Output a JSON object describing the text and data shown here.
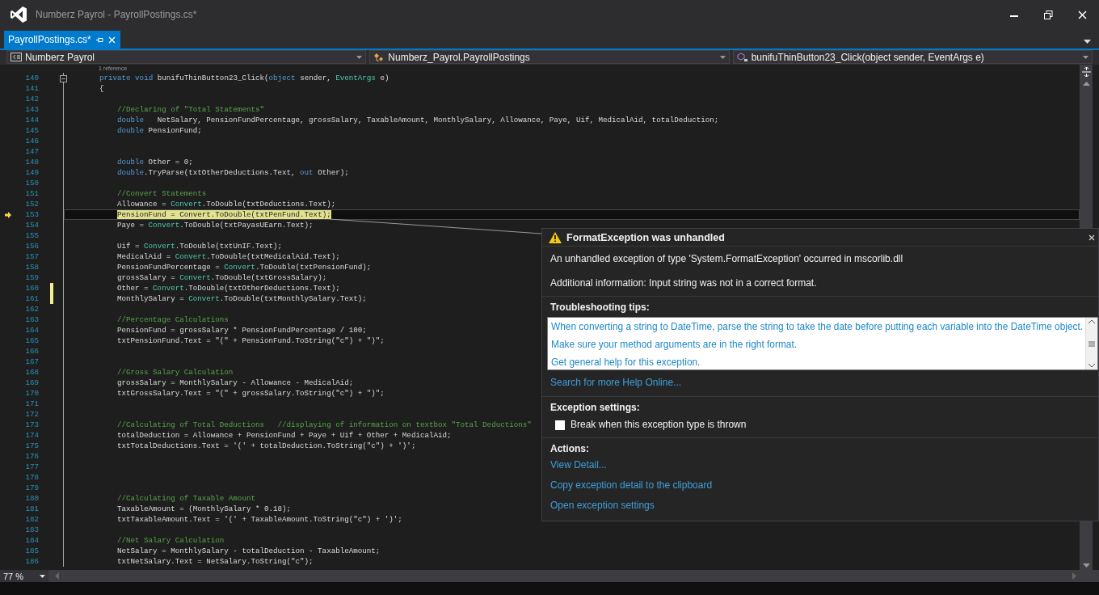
{
  "window": {
    "title": "Numberz Payrol - PayrollPostings.cs*"
  },
  "tabs": [
    {
      "label": "PayrollPostings.cs*",
      "selected": true
    }
  ],
  "navigation_bar": {
    "project": "Numberz Payrol",
    "class": "Numberz_Payrol.PayrollPostings",
    "member": "bunifuThinButton23_Click(object sender, EventArgs e)"
  },
  "editor": {
    "lines": [
      {
        "number": "140",
        "kind": "member",
        "codelens": "1 reference",
        "current": false,
        "changed": false,
        "tokens": [
          {
            "text": "private void",
            "kind": "keyword"
          },
          {
            "text": " bunifuThinButton23_Click(",
            "kind": "plain"
          },
          {
            "text": "object",
            "kind": "keyword"
          },
          {
            "text": " sender, ",
            "kind": "plain"
          },
          {
            "text": "EventArgs",
            "kind": "type"
          },
          {
            "text": " e)",
            "kind": "plain"
          }
        ]
      },
      {
        "number": "141",
        "kind": "member",
        "current": false,
        "changed": false,
        "tokens": [
          {
            "text": "{",
            "kind": "plain"
          }
        ]
      },
      {
        "number": "142",
        "kind": "body",
        "current": false,
        "changed": false
      },
      {
        "number": "143",
        "kind": "body",
        "current": false,
        "changed": false,
        "tokens": [
          {
            "text": "//Declaring of \"Total Statements\"",
            "kind": "comment"
          }
        ]
      },
      {
        "number": "144",
        "kind": "body",
        "current": false,
        "changed": false,
        "tokens": [
          {
            "text": "double",
            "kind": "keyword"
          },
          {
            "text": "   NetSalary, PensionFundPercentage, grossSalary, TaxableAmount, MonthlySalary, Allowance, Paye, Uif, MedicalAid, totalDeduction;",
            "kind": "plain"
          }
        ]
      },
      {
        "number": "145",
        "kind": "body",
        "current": false,
        "changed": false,
        "tokens": [
          {
            "text": "double",
            "kind": "keyword"
          },
          {
            "text": " PensionFund;",
            "kind": "plain"
          }
        ]
      },
      {
        "number": "146",
        "kind": "body",
        "current": false,
        "changed": false
      },
      {
        "number": "147",
        "kind": "body",
        "current": false,
        "changed": false
      },
      {
        "number": "148",
        "kind": "body",
        "current": false,
        "changed": false,
        "tokens": [
          {
            "text": "double",
            "kind": "keyword"
          },
          {
            "text": " Other = 0;",
            "kind": "plain"
          }
        ]
      },
      {
        "number": "149",
        "kind": "body",
        "current": false,
        "changed": false,
        "tokens": [
          {
            "text": "double",
            "kind": "keyword"
          },
          {
            "text": ".TryParse(txtOtherDeductions.Text, ",
            "kind": "plain"
          },
          {
            "text": "out",
            "kind": "keyword"
          },
          {
            "text": " Other);",
            "kind": "plain"
          }
        ]
      },
      {
        "number": "150",
        "kind": "body",
        "current": false,
        "changed": false
      },
      {
        "number": "151",
        "kind": "body",
        "current": false,
        "changed": false,
        "tokens": [
          {
            "text": "//Convert Statements",
            "kind": "comment"
          }
        ]
      },
      {
        "number": "152",
        "kind": "body",
        "current": false,
        "changed": false,
        "tokens": [
          {
            "text": "Allowance = ",
            "kind": "plain"
          },
          {
            "text": "Convert",
            "kind": "type"
          },
          {
            "text": ".ToDouble(txtDeductions.Text);",
            "kind": "plain"
          }
        ]
      },
      {
        "number": "153",
        "kind": "body",
        "current": true,
        "changed": false,
        "tokens": [
          {
            "text": "PensionFund = ",
            "kind": "plain"
          },
          {
            "text": "Convert",
            "kind": "type"
          },
          {
            "text": ".ToDouble(txtPenFund.Text);",
            "kind": "plain"
          }
        ]
      },
      {
        "number": "154",
        "kind": "body",
        "current": false,
        "changed": false,
        "tokens": [
          {
            "text": "Paye = ",
            "kind": "plain"
          },
          {
            "text": "Convert",
            "kind": "type"
          },
          {
            "text": ".ToDouble(txtPayasUEarn.Text);",
            "kind": "plain"
          }
        ]
      },
      {
        "number": "155",
        "kind": "body",
        "current": false,
        "changed": false
      },
      {
        "number": "156",
        "kind": "body",
        "current": false,
        "changed": false,
        "tokens": [
          {
            "text": "Uif = ",
            "kind": "plain"
          },
          {
            "text": "Convert",
            "kind": "type"
          },
          {
            "text": ".ToDouble(txtUnIF.Text);",
            "kind": "plain"
          }
        ]
      },
      {
        "number": "157",
        "kind": "body",
        "current": false,
        "changed": false,
        "tokens": [
          {
            "text": "MedicalAid = ",
            "kind": "plain"
          },
          {
            "text": "Convert",
            "kind": "type"
          },
          {
            "text": ".ToDouble(txtMedicalAid.Text);",
            "kind": "plain"
          }
        ]
      },
      {
        "number": "158",
        "kind": "body",
        "current": false,
        "changed": false,
        "tokens": [
          {
            "text": "PensionFundPercentage = ",
            "kind": "plain"
          },
          {
            "text": "Convert",
            "kind": "type"
          },
          {
            "text": ".ToDouble(txtPensionFund);",
            "kind": "plain"
          }
        ]
      },
      {
        "number": "159",
        "kind": "body",
        "current": false,
        "changed": false,
        "tokens": [
          {
            "text": "grossSalary = ",
            "kind": "plain"
          },
          {
            "text": "Convert",
            "kind": "type"
          },
          {
            "text": ".ToDouble(txtGrossSalary);",
            "kind": "plain"
          }
        ]
      },
      {
        "number": "160",
        "kind": "body",
        "current": false,
        "changed": true,
        "tokens": [
          {
            "text": "Other = ",
            "kind": "plain"
          },
          {
            "text": "Convert",
            "kind": "type"
          },
          {
            "text": ".ToDouble(txtOtherDeductions.Text);",
            "kind": "plain"
          }
        ]
      },
      {
        "number": "161",
        "kind": "body",
        "current": false,
        "changed": true,
        "tokens": [
          {
            "text": "MonthlySalary = ",
            "kind": "plain"
          },
          {
            "text": "Convert",
            "kind": "type"
          },
          {
            "text": ".ToDouble(txtMonthlySalary.Text);",
            "kind": "plain"
          }
        ]
      },
      {
        "number": "162",
        "kind": "body",
        "current": false,
        "changed": false
      },
      {
        "number": "163",
        "kind": "body",
        "current": false,
        "changed": false,
        "tokens": [
          {
            "text": "//Percentage Calculations",
            "kind": "comment"
          }
        ]
      },
      {
        "number": "164",
        "kind": "body",
        "current": false,
        "changed": false,
        "tokens": [
          {
            "text": "PensionFund = grossSalary * PensionFundPercentage / 100;",
            "kind": "plain"
          }
        ]
      },
      {
        "number": "165",
        "kind": "body",
        "current": false,
        "changed": false,
        "tokens": [
          {
            "text": "txtPensionFund.Text = \"(\" + PensionFund.ToString(\"c\") + \")\";",
            "kind": "plain"
          }
        ]
      },
      {
        "number": "166",
        "kind": "body",
        "current": false,
        "changed": false
      },
      {
        "number": "167",
        "kind": "body",
        "current": false,
        "changed": false
      },
      {
        "number": "168",
        "kind": "body",
        "current": false,
        "changed": false,
        "tokens": [
          {
            "text": "//Gross Salary Calculation",
            "kind": "comment"
          }
        ]
      },
      {
        "number": "169",
        "kind": "body",
        "current": false,
        "changed": false,
        "tokens": [
          {
            "text": "grossSalary = MonthlySalary - Allowance - MedicalAid;",
            "kind": "plain"
          }
        ]
      },
      {
        "number": "170",
        "kind": "body",
        "current": false,
        "changed": false,
        "tokens": [
          {
            "text": "txtGrossSalary.Text = \"(\" + grossSalary.ToString(\"c\") + \")\";",
            "kind": "plain"
          }
        ]
      },
      {
        "number": "171",
        "kind": "body",
        "current": false,
        "changed": false
      },
      {
        "number": "172",
        "kind": "body",
        "current": false,
        "changed": false
      },
      {
        "number": "173",
        "kind": "body",
        "current": false,
        "changed": false,
        "tokens": [
          {
            "text": "//Calculating of Total Deductions   //displaying of information on textbox \"Total Deductions\"",
            "kind": "comment"
          }
        ]
      },
      {
        "number": "174",
        "kind": "body",
        "current": false,
        "changed": false,
        "tokens": [
          {
            "text": "totalDeduction = Allowance + PensionFund + Paye + Uif + Other + MedicalAid;",
            "kind": "plain"
          }
        ]
      },
      {
        "number": "175",
        "kind": "body",
        "current": false,
        "changed": false,
        "tokens": [
          {
            "text": "txtTotalDeductions.Text = '(' + totalDeduction.ToString(\"c\") + ')';",
            "kind": "plain"
          }
        ]
      },
      {
        "number": "176",
        "kind": "body",
        "current": false,
        "changed": false
      },
      {
        "number": "177",
        "kind": "body",
        "current": false,
        "changed": false
      },
      {
        "number": "178",
        "kind": "body",
        "current": false,
        "changed": false
      },
      {
        "number": "179",
        "kind": "body",
        "current": false,
        "changed": false
      },
      {
        "number": "180",
        "kind": "body",
        "current": false,
        "changed": false,
        "tokens": [
          {
            "text": "//Calculating of Taxable Amount",
            "kind": "comment"
          }
        ]
      },
      {
        "number": "181",
        "kind": "body",
        "current": false,
        "changed": false,
        "tokens": [
          {
            "text": "TaxableAmount = (MonthlySalary * 0.18);",
            "kind": "plain"
          }
        ]
      },
      {
        "number": "182",
        "kind": "body",
        "current": false,
        "changed": false,
        "tokens": [
          {
            "text": "txtTaxableAmount.Text = '(' + TaxableAmount.ToString(\"c\") + ')';",
            "kind": "plain"
          }
        ]
      },
      {
        "number": "183",
        "kind": "body",
        "current": false,
        "changed": false
      },
      {
        "number": "184",
        "kind": "body",
        "current": false,
        "changed": false,
        "tokens": [
          {
            "text": "//Net Salary Calculation",
            "kind": "comment"
          }
        ]
      },
      {
        "number": "185",
        "kind": "body",
        "current": false,
        "changed": false,
        "tokens": [
          {
            "text": "NetSalary = MonthlySalary - totalDeduction - TaxableAmount;",
            "kind": "plain"
          }
        ]
      },
      {
        "number": "186",
        "kind": "body",
        "current": false,
        "changed": false,
        "tokens": [
          {
            "text": "txtNetSalary.Text = NetSalary.ToString(\"c\");",
            "kind": "plain"
          }
        ]
      }
    ]
  },
  "zoom": "77 %",
  "exception_popup": {
    "title": "FormatException was unhandled",
    "message": "An unhandled exception of type 'System.FormatException' occurred in mscorlib.dll",
    "additional_info": "Additional information: Input string was not in a correct format.",
    "tips_heading": "Troubleshooting tips:",
    "tips": [
      "When converting a string to DateTime, parse the string to take the date before putting each variable into the DateTime object.",
      "Make sure your method arguments are in the right format.",
      "Get general help for this exception."
    ],
    "search_link": "Search for more Help Online...",
    "settings_heading": "Exception settings:",
    "break_option": {
      "label": "Break when this exception type is thrown",
      "checked": false
    },
    "actions_heading": "Actions:",
    "actions": [
      "View Detail...",
      "Copy exception detail to the clipboard",
      "Open exception settings"
    ]
  }
}
